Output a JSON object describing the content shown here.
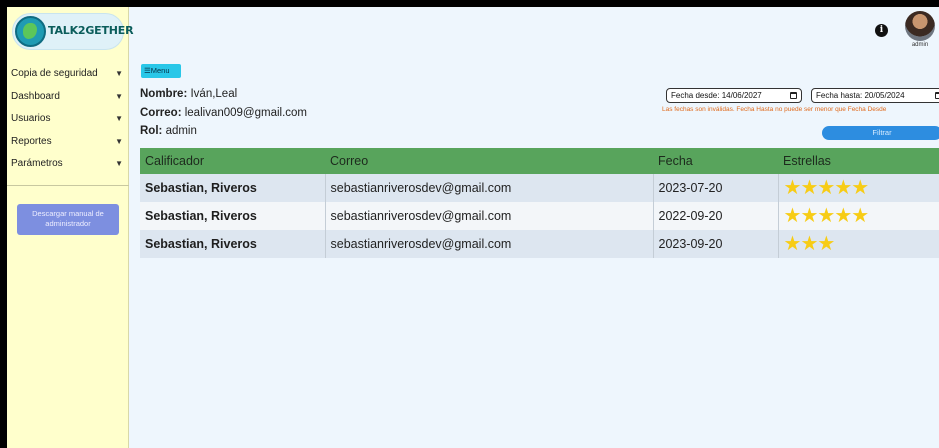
{
  "brand": {
    "logo_text": "TALK2GETHER"
  },
  "sidebar": {
    "items": [
      {
        "label": "Copia de seguridad"
      },
      {
        "label": "Dashboard"
      },
      {
        "label": "Usuarios"
      },
      {
        "label": "Reportes"
      },
      {
        "label": "Parámetros"
      }
    ],
    "manual_button": "Descargar manual de administrador"
  },
  "header": {
    "user_label": "admin"
  },
  "toolbar": {
    "menu_label": "☰Menu"
  },
  "profile": {
    "name_label": "Nombre:",
    "name_value": "Iván,Leal",
    "email_label": "Correo:",
    "email_value": "lealivan009@gmail.com",
    "role_label": "Rol:",
    "role_value": "admin"
  },
  "filters": {
    "from_label": "Fecha desde:",
    "from_value": "14/06/2027",
    "to_label": "Fecha hasta:",
    "to_value": "20/05/2024",
    "warning": "Las fechas son inválidas. Fecha Hasta no puede ser menor que Fecha Desde",
    "filter_button": "Filtrar"
  },
  "table": {
    "columns": [
      "Calificador",
      "Correo",
      "Fecha",
      "Estrellas"
    ],
    "rows": [
      {
        "rater": "Sebastian, Riveros",
        "email": "sebastianriverosdev@gmail.com",
        "date": "2023-07-20",
        "stars": 5
      },
      {
        "rater": "Sebastian, Riveros",
        "email": "sebastianriverosdev@gmail.com",
        "date": "2022-09-20",
        "stars": 5
      },
      {
        "rater": "Sebastian, Riveros",
        "email": "sebastianriverosdev@gmail.com",
        "date": "2023-09-20",
        "stars": 3
      }
    ]
  },
  "colors": {
    "table_header": "#58a45c",
    "star": "#f7cc15",
    "warning": "#e06a1c",
    "sidebar": "#ffffcc"
  }
}
